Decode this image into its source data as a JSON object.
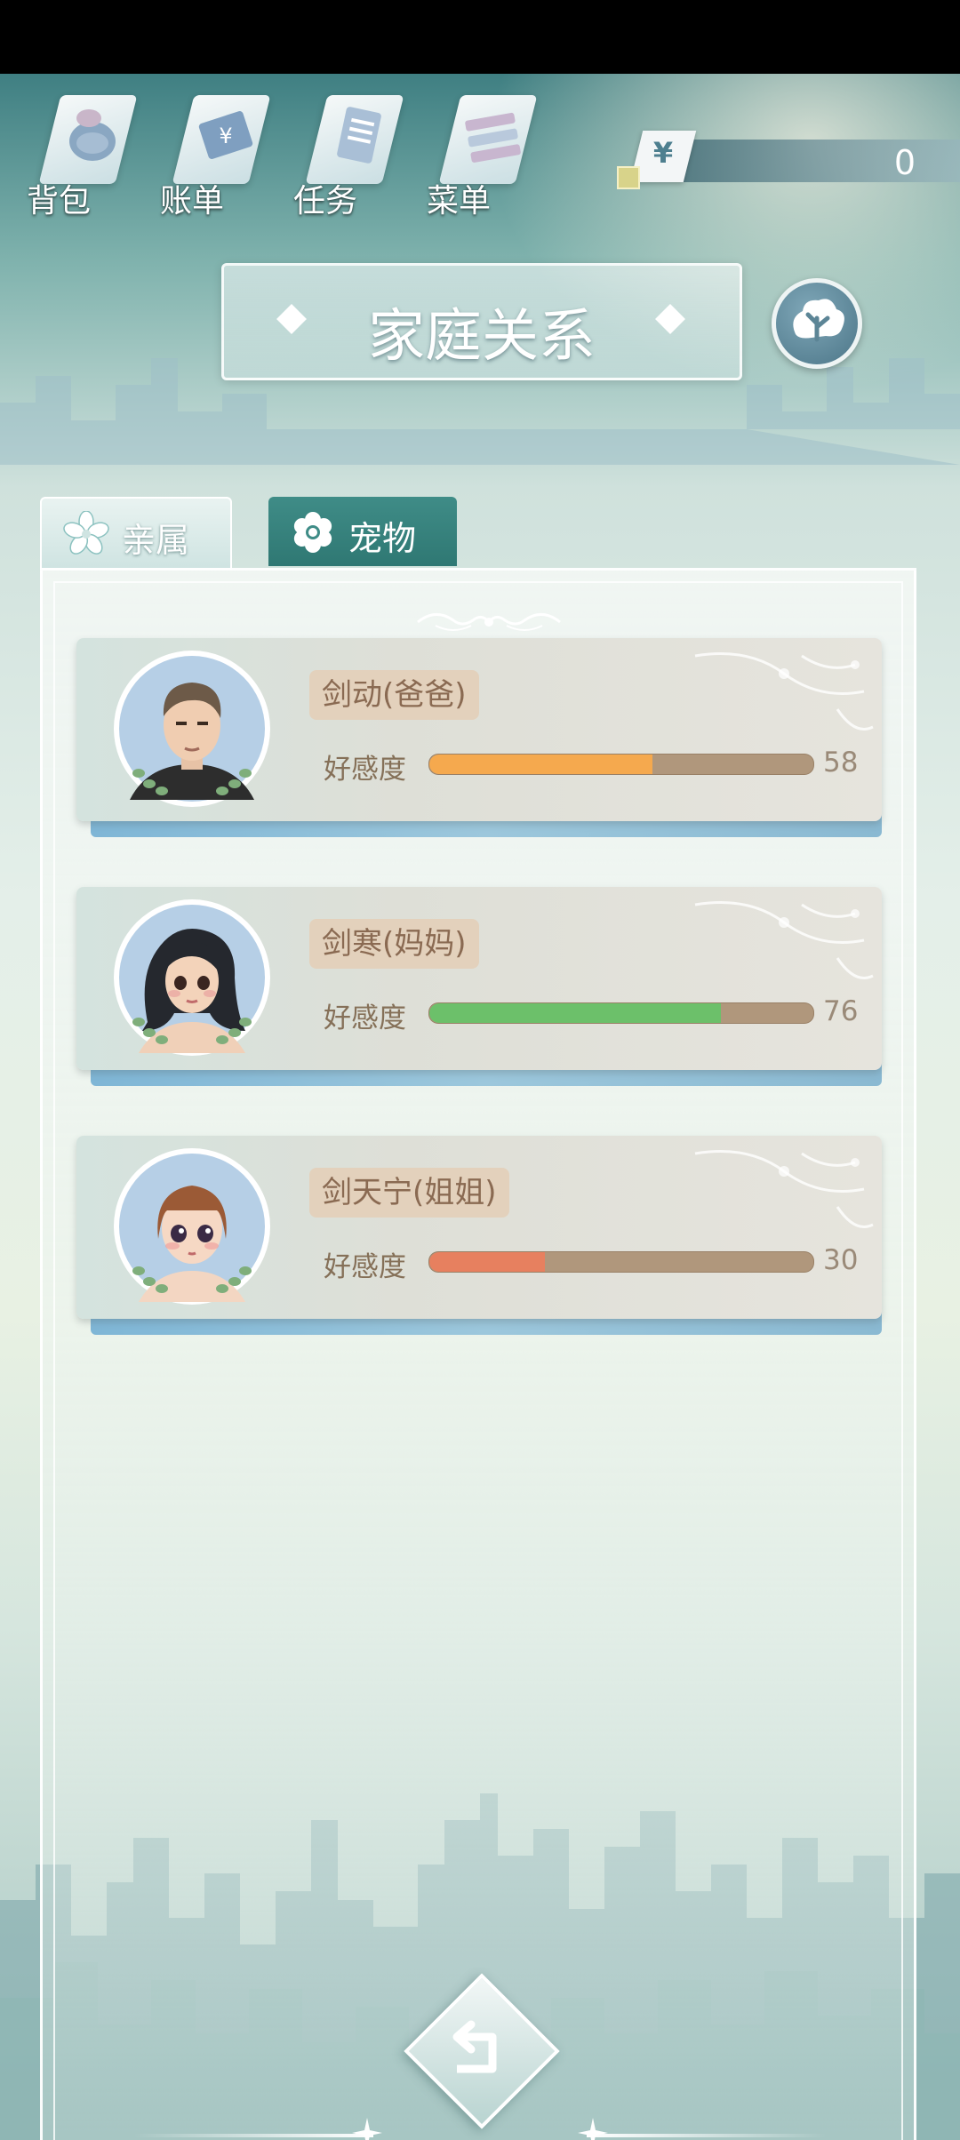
{
  "nav": {
    "items": [
      {
        "label": "背包",
        "icon": "backpack-icon"
      },
      {
        "label": "账单",
        "icon": "bill-icon"
      },
      {
        "label": "任务",
        "icon": "task-icon"
      },
      {
        "label": "菜单",
        "icon": "menu-icon"
      }
    ]
  },
  "currency": {
    "symbol": "¥",
    "value": "0"
  },
  "header": {
    "title": "家庭关系"
  },
  "tabs": [
    {
      "label": "亲属",
      "icon": "flower-icon"
    },
    {
      "label": "宠物",
      "icon": "flower-icon"
    }
  ],
  "members": [
    {
      "name": "剑动(爸爸)",
      "affinity_label": "好感度",
      "affinity": "58",
      "fill_percent": 58,
      "bar_color": "#f5a94e"
    },
    {
      "name": "剑寒(妈妈)",
      "affinity_label": "好感度",
      "affinity": "76",
      "fill_percent": 76,
      "bar_color": "#6cc06a"
    },
    {
      "name": "剑天宁(姐姐)",
      "affinity_label": "好感度",
      "affinity": "30",
      "fill_percent": 30,
      "bar_color": "#e7805f"
    }
  ],
  "colors": {
    "accent": "#3f8c87",
    "chip": "#e3d1bc"
  }
}
